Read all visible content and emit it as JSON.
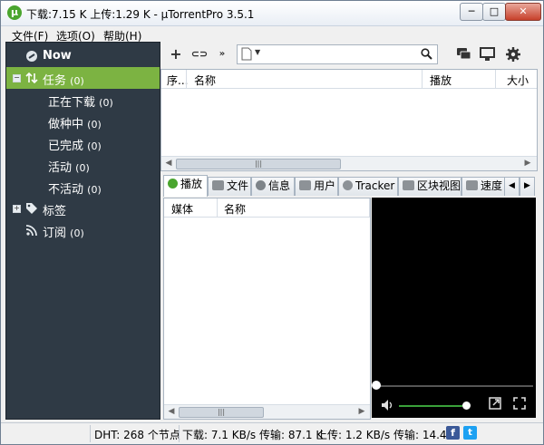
{
  "window": {
    "title": "下载:7.15 K 上传:1.29 K - µTorrentPro 3.5.1",
    "controls": {
      "minimize": "─",
      "maximize": "□",
      "close": "✕"
    }
  },
  "menu": [
    {
      "label": "文件(F)"
    },
    {
      "label": "选项(O)"
    },
    {
      "label": "帮助(H)"
    }
  ],
  "sidebar": {
    "now": "Now",
    "tasks": {
      "label": "任务",
      "count": "(0)"
    },
    "items": [
      {
        "label": "正在下载",
        "count": "(0)"
      },
      {
        "label": "做种中",
        "count": "(0)"
      },
      {
        "label": "已完成",
        "count": "(0)"
      },
      {
        "label": "活动",
        "count": "(0)"
      },
      {
        "label": "不活动",
        "count": "(0)"
      }
    ],
    "tags": {
      "label": "标签"
    },
    "subscriptions": {
      "label": "订阅",
      "count": "(0)"
    }
  },
  "toolbar": {
    "add": "+",
    "link": "⊂⊃",
    "more": "»",
    "search_placeholder": ""
  },
  "torrent_list": {
    "columns": [
      "序...",
      "名称",
      "播放",
      "大小"
    ]
  },
  "tabs": [
    {
      "label": "播放",
      "active": true
    },
    {
      "label": "文件"
    },
    {
      "label": "信息"
    },
    {
      "label": "用户"
    },
    {
      "label": "Tracker"
    },
    {
      "label": "区块视图"
    },
    {
      "label": "速度"
    }
  ],
  "media_list": {
    "columns": [
      "媒体",
      "名称"
    ]
  },
  "status": {
    "dht": "DHT: 268 个节点",
    "download": "下载: 7.1 KB/s 传输: 87.1 K",
    "upload": "上传: 1.2 KB/s 传输: 14.4 K"
  },
  "colors": {
    "sidebar_bg": "#2f3a45",
    "sidebar_active": "#7cb342",
    "accent_green": "#4aa52e",
    "facebook": "#3b5998",
    "twitter": "#1da1f2"
  }
}
